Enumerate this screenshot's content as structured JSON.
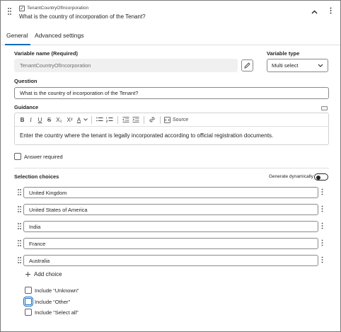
{
  "header": {
    "variable_name": "TenantCountryOfIncorporation",
    "question": "What is the country of incorporation of the Tenant?",
    "collapse_icon": "chevron-up-icon",
    "more_icon": "more-vertical-icon"
  },
  "tabs": [
    {
      "label": "General",
      "selected": true
    },
    {
      "label": "Advanced settings",
      "selected": false
    }
  ],
  "variable_name_field": {
    "label": "Variable name (Required)",
    "value": "TenantCountryOfIncorporation",
    "edit_icon": "pencil-icon"
  },
  "variable_type": {
    "label": "Variable type",
    "value": "Multi select"
  },
  "question_field": {
    "label": "Question",
    "value": "What is the country of incorporation of the Tenant?"
  },
  "guidance": {
    "label": "Guidance",
    "toolbar": {
      "bold": "B",
      "italic": "I",
      "underline": "U",
      "strike": "S",
      "subscript": "X₂",
      "superscript": "X²",
      "font_color": "A",
      "source": "Source"
    },
    "content": "Enter the country where the tenant is legally incorporated according to official registration documents."
  },
  "answer_required": {
    "label": "Answer required",
    "checked": false
  },
  "selection_choices": {
    "label": "Selection choices",
    "generate_dynamically_label": "Generate dynamically",
    "generate_dynamically": false,
    "choices": [
      "United Kingdom",
      "United States of America",
      "India",
      "France",
      "Australia"
    ],
    "add_choice_label": "Add choice"
  },
  "include_options": [
    {
      "label": "Include “Unknown”",
      "checked": false,
      "focused": false
    },
    {
      "label": "Include “Other”",
      "checked": false,
      "focused": true
    },
    {
      "label": "Include “Select all”",
      "checked": false,
      "focused": false
    }
  ],
  "colors": {
    "accent": "#0f6cbd",
    "border": "#8a8a8a",
    "text": "#242424"
  }
}
